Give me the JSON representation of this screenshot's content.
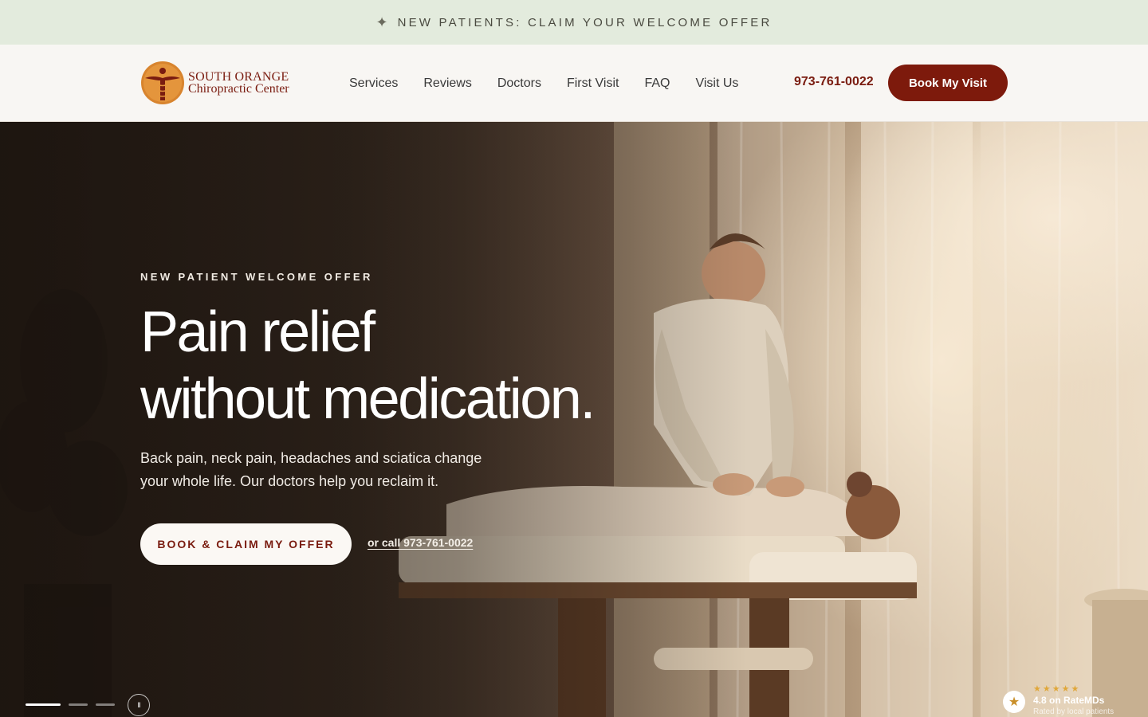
{
  "announcement": {
    "icon": "sparkle-icon",
    "text": "NEW PATIENTS: CLAIM YOUR WELCOME OFFER"
  },
  "brand": {
    "line1": "SOUTH ORANGE",
    "line2": "Chiropractic Center"
  },
  "nav": {
    "items": [
      "Services",
      "Reviews",
      "Doctors",
      "First Visit",
      "FAQ",
      "Visit Us"
    ]
  },
  "header": {
    "phone": "973-761-0022",
    "book_label": "Book My Visit"
  },
  "hero": {
    "eyebrow": "NEW PATIENT WELCOME OFFER",
    "headline_line1": "Pain relief",
    "headline_line2": "without medication.",
    "subtext": "Back pain, neck pain, headaches and sciatica change your whole life. Our doctors help you reclaim it.",
    "cta_label": "BOOK & CLAIM MY OFFER",
    "call_label": "or call 973-761-0022"
  },
  "carousel": {
    "active_slide": 1,
    "slide_count": 3,
    "pause_label": "II"
  },
  "rating": {
    "stars": "★★★★★",
    "score": "4.8 on RateMDs",
    "note": "Rated by local patients"
  },
  "colors": {
    "brand": "#7d1a0c",
    "announce_bg": "#e3ebdd",
    "header_bg": "#f8f6f3"
  }
}
